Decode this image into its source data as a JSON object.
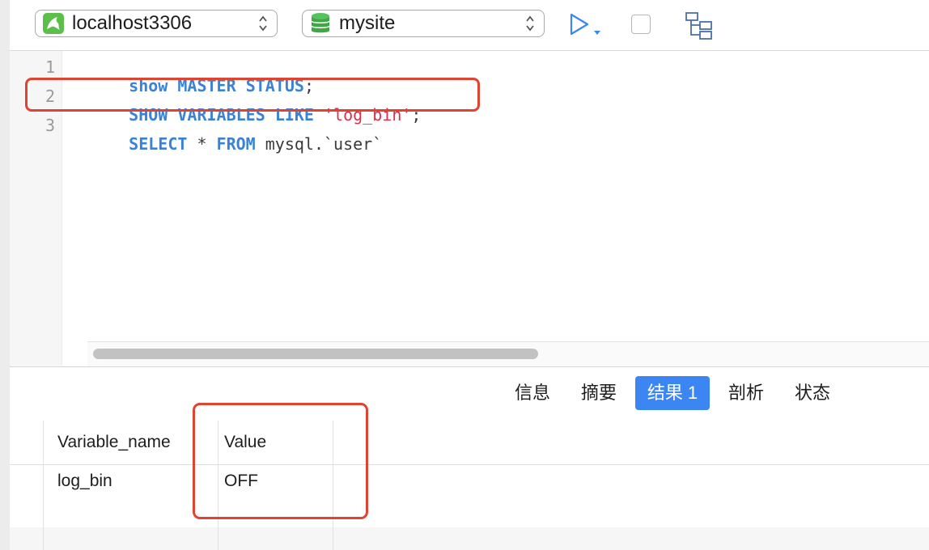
{
  "toolbar": {
    "connection": {
      "label": "localhost3306",
      "icon": "mysql-dolphin-icon"
    },
    "database": {
      "label": "mysite",
      "icon": "database-cylinder-icon"
    },
    "run_icon": "play-icon",
    "stop_icon": "stop-icon",
    "explain_icon": "query-plan-icon"
  },
  "editor": {
    "line_numbers": [
      "1",
      "2",
      "3"
    ],
    "lines": [
      {
        "tokens": [
          {
            "t": "show",
            "c": "kw"
          },
          {
            "t": " ",
            "c": "plain"
          },
          {
            "t": "MASTER",
            "c": "kw"
          },
          {
            "t": " ",
            "c": "plain"
          },
          {
            "t": "STATUS",
            "c": "kw"
          },
          {
            "t": ";",
            "c": "plain"
          }
        ]
      },
      {
        "tokens": [
          {
            "t": "SHOW",
            "c": "kw"
          },
          {
            "t": " ",
            "c": "plain"
          },
          {
            "t": "VARIABLES",
            "c": "kw"
          },
          {
            "t": " ",
            "c": "plain"
          },
          {
            "t": "LIKE",
            "c": "kw"
          },
          {
            "t": " ",
            "c": "plain"
          },
          {
            "t": "'log_bin'",
            "c": "str"
          },
          {
            "t": ";",
            "c": "plain"
          }
        ]
      },
      {
        "tokens": [
          {
            "t": "SELECT",
            "c": "kw"
          },
          {
            "t": " * ",
            "c": "plain"
          },
          {
            "t": "FROM",
            "c": "kw"
          },
          {
            "t": " mysql.`user`",
            "c": "plain"
          }
        ]
      }
    ]
  },
  "tabs": [
    {
      "label": "信息",
      "active": false
    },
    {
      "label": "摘要",
      "active": false
    },
    {
      "label": "结果 1",
      "active": true
    },
    {
      "label": "剖析",
      "active": false
    },
    {
      "label": "状态",
      "active": false
    }
  ],
  "result": {
    "columns": [
      "Variable_name",
      "Value"
    ],
    "rows": [
      [
        "log_bin",
        "OFF"
      ]
    ]
  },
  "colors": {
    "keyword": "#3b82d6",
    "string": "#d4344b",
    "highlight_box": "#e0432f",
    "active_tab": "#3b86f2"
  }
}
